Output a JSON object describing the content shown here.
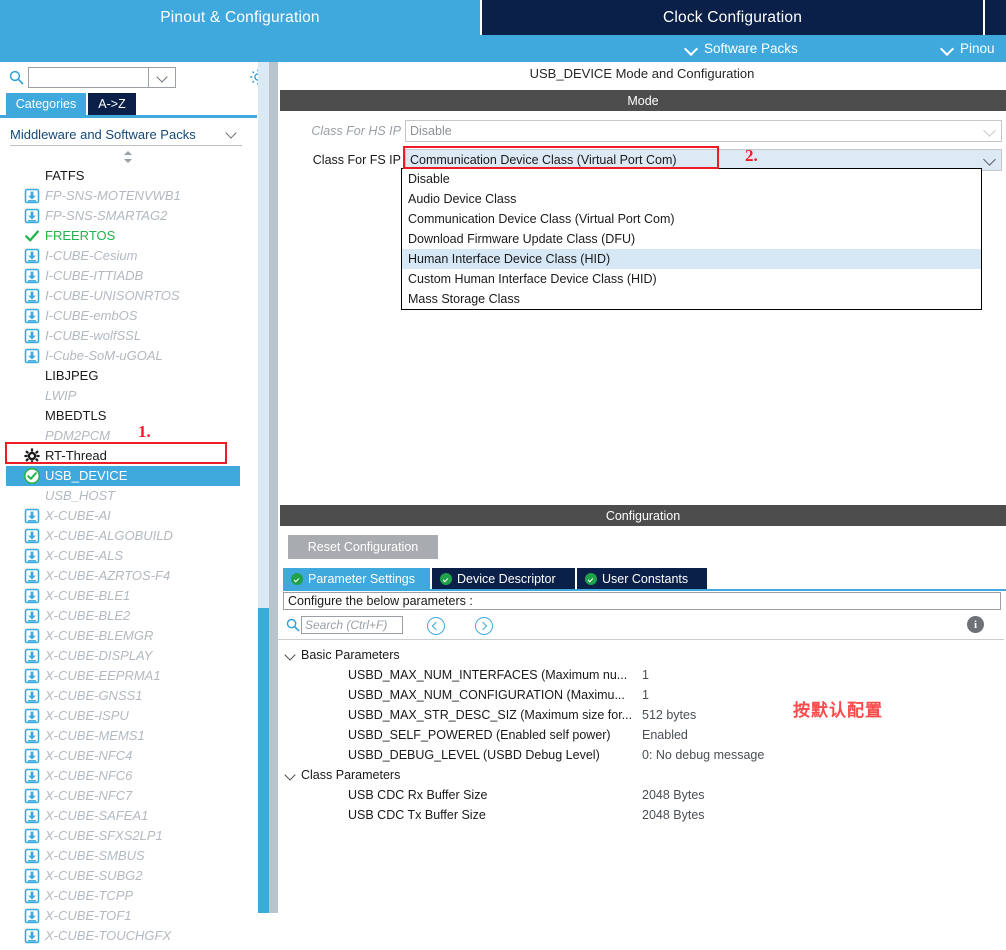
{
  "window": {
    "tabs": [
      {
        "label": "Pinout & Configuration",
        "active": true
      },
      {
        "label": "Clock Configuration",
        "active": false
      },
      {
        "label": "",
        "active": false
      }
    ],
    "subbar": [
      {
        "label": "Software Packs",
        "icon": "chevron-down-icon"
      },
      {
        "label": "Pinou",
        "icon": "chevron-down-icon"
      }
    ]
  },
  "sidebar": {
    "search": {
      "value": "",
      "placeholder": ""
    },
    "gear_icon": "gear-icon",
    "category_tabs": [
      {
        "label": "Categories",
        "active": true
      },
      {
        "label": "A->Z",
        "active": false
      }
    ],
    "group_header": "Middleware and Software Packs",
    "items": [
      {
        "label": "FATFS",
        "state": "plain",
        "icon": "none"
      },
      {
        "label": "FP-SNS-MOTENVWB1",
        "state": "dim",
        "icon": "download-icon"
      },
      {
        "label": "FP-SNS-SMARTAG2",
        "state": "dim",
        "icon": "download-icon"
      },
      {
        "label": "FREERTOS",
        "state": "green",
        "icon": "check-icon"
      },
      {
        "label": "I-CUBE-Cesium",
        "state": "dim",
        "icon": "download-icon"
      },
      {
        "label": "I-CUBE-ITTIADB",
        "state": "dim",
        "icon": "download-icon"
      },
      {
        "label": "I-CUBE-UNISONRTOS",
        "state": "dim",
        "icon": "download-icon"
      },
      {
        "label": "I-CUBE-embOS",
        "state": "dim",
        "icon": "download-icon"
      },
      {
        "label": "I-CUBE-wolfSSL",
        "state": "dim",
        "icon": "download-icon"
      },
      {
        "label": "I-Cube-SoM-uGOAL",
        "state": "dim",
        "icon": "download-icon"
      },
      {
        "label": "LIBJPEG",
        "state": "plain",
        "icon": "none"
      },
      {
        "label": "LWIP",
        "state": "dim",
        "icon": "none"
      },
      {
        "label": "MBEDTLS",
        "state": "plain",
        "icon": "none"
      },
      {
        "label": "PDM2PCM",
        "state": "dim",
        "icon": "none"
      },
      {
        "label": "RT-Thread",
        "state": "plain",
        "icon": "gear-solid-icon"
      },
      {
        "label": "USB_DEVICE",
        "state": "selected",
        "icon": "check-circle-icon"
      },
      {
        "label": "USB_HOST",
        "state": "dim",
        "icon": "none"
      },
      {
        "label": "X-CUBE-AI",
        "state": "dim",
        "icon": "download-icon"
      },
      {
        "label": "X-CUBE-ALGOBUILD",
        "state": "dim",
        "icon": "download-icon"
      },
      {
        "label": "X-CUBE-ALS",
        "state": "dim",
        "icon": "download-icon"
      },
      {
        "label": "X-CUBE-AZRTOS-F4",
        "state": "dim",
        "icon": "download-icon"
      },
      {
        "label": "X-CUBE-BLE1",
        "state": "dim",
        "icon": "download-icon"
      },
      {
        "label": "X-CUBE-BLE2",
        "state": "dim",
        "icon": "download-icon"
      },
      {
        "label": "X-CUBE-BLEMGR",
        "state": "dim",
        "icon": "download-icon"
      },
      {
        "label": "X-CUBE-DISPLAY",
        "state": "dim",
        "icon": "download-icon"
      },
      {
        "label": "X-CUBE-EEPRMA1",
        "state": "dim",
        "icon": "download-icon"
      },
      {
        "label": "X-CUBE-GNSS1",
        "state": "dim",
        "icon": "download-icon"
      },
      {
        "label": "X-CUBE-ISPU",
        "state": "dim",
        "icon": "download-icon"
      },
      {
        "label": "X-CUBE-MEMS1",
        "state": "dim",
        "icon": "download-icon"
      },
      {
        "label": "X-CUBE-NFC4",
        "state": "dim",
        "icon": "download-icon"
      },
      {
        "label": "X-CUBE-NFC6",
        "state": "dim",
        "icon": "download-icon"
      },
      {
        "label": "X-CUBE-NFC7",
        "state": "dim",
        "icon": "download-icon"
      },
      {
        "label": "X-CUBE-SAFEA1",
        "state": "dim",
        "icon": "download-icon"
      },
      {
        "label": "X-CUBE-SFXS2LP1",
        "state": "dim",
        "icon": "download-icon"
      },
      {
        "label": "X-CUBE-SMBUS",
        "state": "dim",
        "icon": "download-icon"
      },
      {
        "label": "X-CUBE-SUBG2",
        "state": "dim",
        "icon": "download-icon"
      },
      {
        "label": "X-CUBE-TCPP",
        "state": "dim",
        "icon": "download-icon"
      },
      {
        "label": "X-CUBE-TOF1",
        "state": "dim",
        "icon": "download-icon"
      },
      {
        "label": "X-CUBE-TOUCHGFX",
        "state": "dim",
        "icon": "download-icon"
      }
    ]
  },
  "main": {
    "title": "USB_DEVICE Mode and Configuration",
    "mode": {
      "header": "Mode",
      "fields": [
        {
          "label": "Class For HS IP",
          "value": "Disable",
          "enabled": false
        },
        {
          "label": "Class For FS IP",
          "value": "Communication Device Class (Virtual Port Com)",
          "enabled": true
        }
      ],
      "dropdown_options": [
        {
          "label": "Disable",
          "highlighted": false
        },
        {
          "label": "Audio Device Class",
          "highlighted": false
        },
        {
          "label": "Communication Device Class (Virtual Port Com)",
          "highlighted": false
        },
        {
          "label": "Download Firmware Update Class (DFU)",
          "highlighted": false
        },
        {
          "label": "Human Interface Device Class (HID)",
          "highlighted": true
        },
        {
          "label": "Custom Human Interface Device Class (HID)",
          "highlighted": false
        },
        {
          "label": "Mass Storage Class",
          "highlighted": false
        }
      ]
    },
    "configuration": {
      "header": "Configuration",
      "reset_button": "Reset Configuration",
      "tabs": [
        {
          "label": "Parameter Settings",
          "active": true
        },
        {
          "label": "Device Descriptor",
          "active": false
        },
        {
          "label": "User Constants",
          "active": false
        }
      ],
      "instruction": "Configure the below parameters :",
      "search": {
        "value": "",
        "placeholder": "Search (Ctrl+F)"
      },
      "prev_icon": "chevron-left-circle-icon",
      "next_icon": "chevron-right-circle-icon",
      "info_icon": "info-icon",
      "info_glyph": "i",
      "groups": [
        {
          "name": "Basic Parameters",
          "rows": [
            {
              "name": "USBD_MAX_NUM_INTERFACES (Maximum nu...",
              "value": "1"
            },
            {
              "name": "USBD_MAX_NUM_CONFIGURATION (Maximu...",
              "value": "1"
            },
            {
              "name": "USBD_MAX_STR_DESC_SIZ (Maximum size for...",
              "value": "512 bytes"
            },
            {
              "name": "USBD_SELF_POWERED (Enabled self power)",
              "value": "Enabled"
            },
            {
              "name": "USBD_DEBUG_LEVEL (USBD Debug Level)",
              "value": "0: No debug message"
            }
          ]
        },
        {
          "name": "Class Parameters",
          "rows": [
            {
              "name": "USB CDC Rx Buffer Size",
              "value": "2048 Bytes"
            },
            {
              "name": "USB CDC Tx Buffer Size",
              "value": "2048 Bytes"
            }
          ]
        }
      ]
    }
  },
  "annotations": {
    "step1": "1.",
    "step2": "2.",
    "note_cn": "按默认配置"
  },
  "colors": {
    "accent_blue": "#3fa9dd",
    "dark_navy": "#0b2049",
    "annotation_red": "#ee1c25",
    "note_red": "#fb4a4a",
    "dark_gray_bar": "#4d4d4d",
    "green_check": "#24b24b"
  }
}
